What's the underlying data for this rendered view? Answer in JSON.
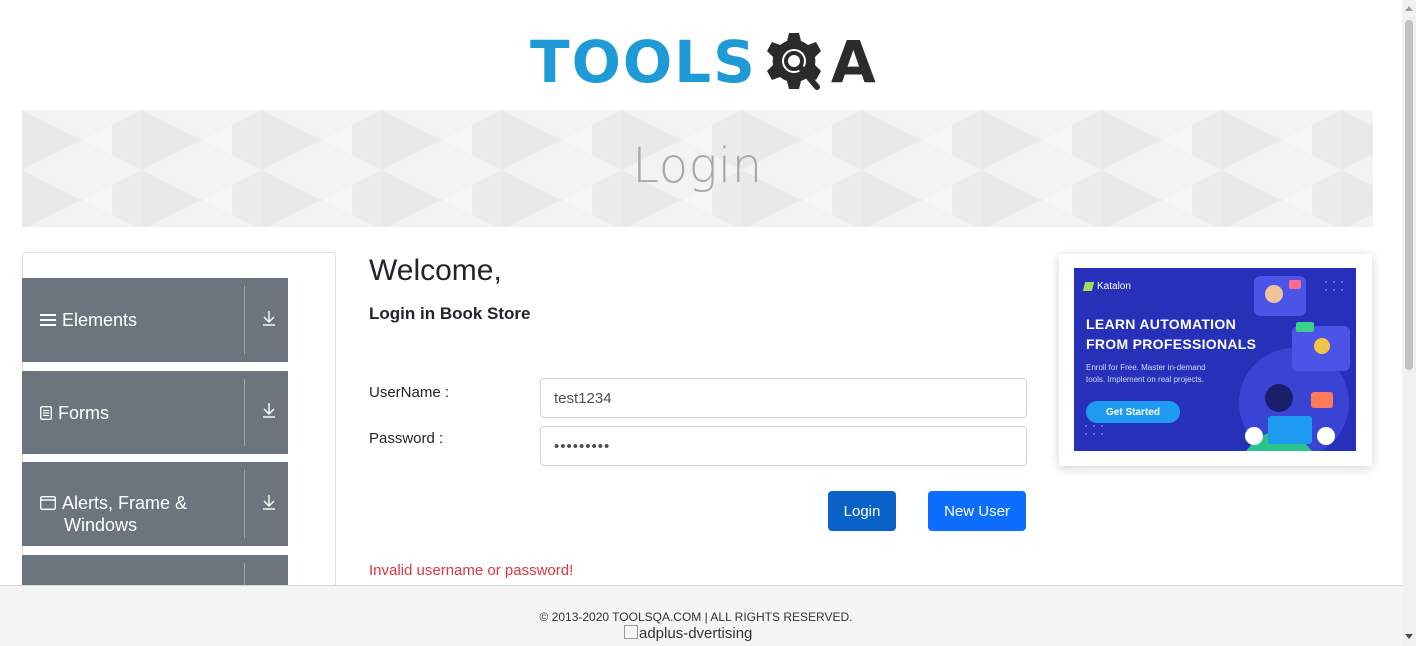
{
  "header": {
    "logo_part1": "TOOLS",
    "logo_part2": "A",
    "logo_icon": "gear-magnifier-icon"
  },
  "banner": {
    "title": "Login"
  },
  "sidebar": {
    "items": [
      {
        "label": "Elements",
        "icon": "hamburger-icon",
        "arrow": "⤓"
      },
      {
        "label": "Forms",
        "icon": "document-icon",
        "arrow": "⤓"
      },
      {
        "label": "Alerts, Frame &",
        "label2": "Windows",
        "icon": "window-icon",
        "arrow": "⤓"
      },
      {
        "label": "",
        "icon": "",
        "arrow": ""
      }
    ]
  },
  "main": {
    "welcome": "Welcome,",
    "subtitle": "Login in Book Store",
    "username_label": "UserName :",
    "username_value": "test1234",
    "password_label": "Password :",
    "password_value": "•••••••••",
    "login_button": "Login",
    "new_user_button": "New User",
    "error": "Invalid username or password!"
  },
  "ad": {
    "brand": "Katalon",
    "headline1": "LEARN AUTOMATION",
    "headline2": "FROM PROFESSIONALS",
    "desc1": "Enroll for Free. Master in-demand",
    "desc2": "tools. Implement on real projects.",
    "cta": "Get Started"
  },
  "footer": {
    "copyright": "© 2013-2020 TOOLSQA.COM | ALL RIGHTS RESERVED.",
    "ad_alt": "adplus-dvertising"
  },
  "colors": {
    "brand_blue": "#1e9bd7",
    "menu_gray": "#6c757d",
    "primary": "#0d6efd",
    "error": "#dc3545",
    "ad_bg": "#2730b8"
  }
}
